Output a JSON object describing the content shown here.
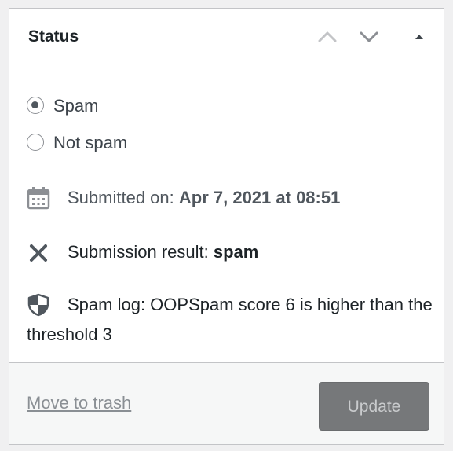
{
  "panel": {
    "title": "Status"
  },
  "header_controls": [
    {
      "name": "move-up-icon"
    },
    {
      "name": "move-down-icon"
    },
    {
      "name": "toggle-panel-icon"
    }
  ],
  "status_options": {
    "spam_label": "Spam",
    "not_spam_label": "Not spam",
    "selected": "Spam"
  },
  "submitted": {
    "icon": "calendar-icon",
    "label": "Submitted on:",
    "value": "Apr 7, 2021 at 08:51"
  },
  "result": {
    "icon": "close-x-icon",
    "label": "Submission result:",
    "value": "spam"
  },
  "spam_log": {
    "icon": "shield-icon",
    "text": "Spam log: OOPSpam score 6 is higher than the threshold 3"
  },
  "footer": {
    "trash_label": "Move to trash",
    "update_label": "Update"
  },
  "colors": {
    "border": "#c3c4c7",
    "footer_bg": "#f6f7f7",
    "button_bg": "#76787a"
  }
}
